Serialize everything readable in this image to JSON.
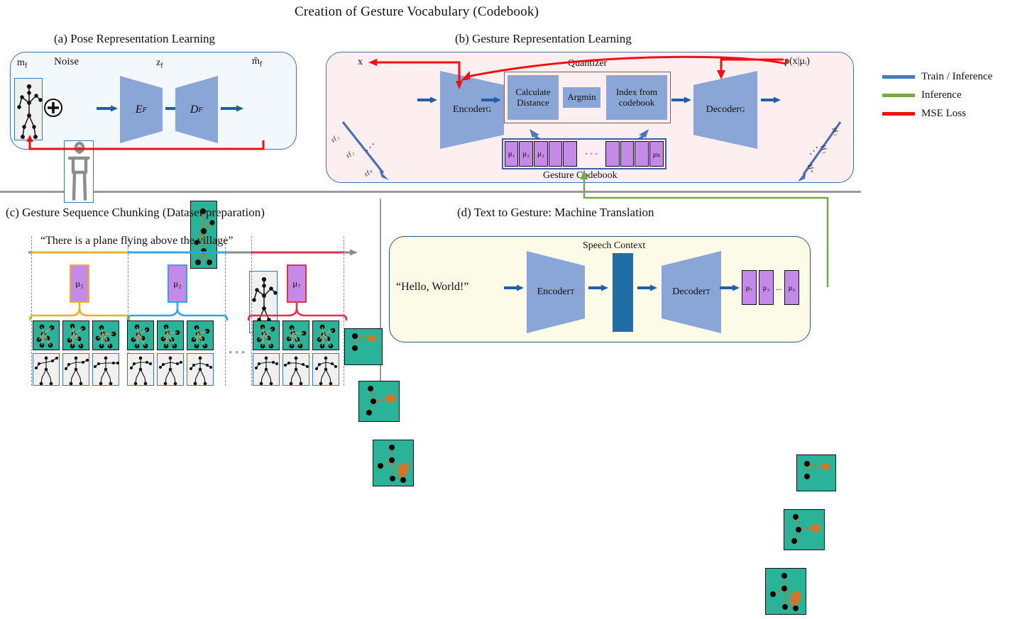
{
  "title": "Creation of Gesture Vocabulary (Codebook)",
  "panels": {
    "a": {
      "caption": "(a) Pose Representation Learning",
      "input_label": "m_f",
      "noise_label": "Noise",
      "latent_label": "z_f",
      "output_label": "m̂_f",
      "encoder": "E_F",
      "decoder": "D_F",
      "plus_symbol": "+"
    },
    "b": {
      "caption": "(b) Gesture Representation Learning",
      "x_label": "x",
      "px_label": "p(x|μᵢ)",
      "encoder": "Encoder",
      "encoder_sub": "G",
      "decoder": "Decoder",
      "decoder_sub": "G",
      "quantizer_label": "Quantizer",
      "quantizer_blocks": [
        "Calculate Distance",
        "Argmin",
        "Index from codebook"
      ],
      "codebook_label": "Gesture Codebook",
      "codebook_cells": [
        "μ₁",
        "μ₂",
        "μ₃",
        "",
        "",
        "",
        "",
        "",
        "μₖ"
      ],
      "codebook_ellipsis": "• • •",
      "input_seq_labels": [
        "zƒ₁",
        "zƒ₂",
        "zƒₙ"
      ],
      "output_seq_labels": [
        "ẑƒ₁",
        "ẑƒ₂",
        "ẑƒₙ"
      ],
      "seq_ellipsis": "⋰"
    },
    "c": {
      "caption": "(c) Gesture Sequence Chunking (Dataset preparation)",
      "sentence": "“There is a plane flying above the village”",
      "chunks": [
        {
          "token": "μ₅",
          "color": "#e8b21e"
        },
        {
          "token": "μ₂",
          "color": "#2ea8e0"
        },
        {
          "token": "μ₇",
          "color": "#e03050"
        }
      ],
      "ellipsis": "• • •"
    },
    "d": {
      "caption": "(d) Text to Gesture: Machine Translation",
      "input_text": "“Hello, World!”",
      "encoder": "Encoder",
      "encoder_sub": "T",
      "decoder": "Decoder",
      "decoder_sub": "T",
      "context_label": "Speech Context",
      "outputs": [
        "μ₇",
        "μ₃",
        "μ₉"
      ],
      "output_ellipsis": "..."
    }
  },
  "legend": {
    "items": [
      {
        "label": "Train / Inference",
        "color": "#4a78b8"
      },
      {
        "label": "Inference",
        "color": "#7aa84f"
      },
      {
        "label": "MSE Loss",
        "color": "#ee1111"
      }
    ]
  },
  "colors": {
    "teal": "#2bb39a",
    "trapezoid_blue": "#8aa6d6",
    "mu_purple": "#c48ae8",
    "panel_b_bg": "#fdeef0",
    "panel_d_bg": "#fbfbe8",
    "panel_a_bg": "#f3f8fd",
    "context_blue": "#1f6ea8",
    "arrow_blue": "#1f5fa8",
    "arrow_red": "#ee1111",
    "arrow_green": "#7aa84f"
  }
}
